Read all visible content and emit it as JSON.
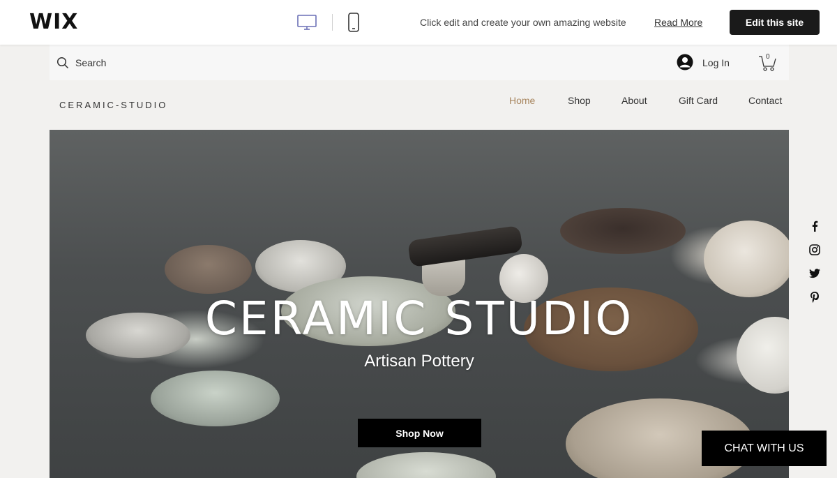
{
  "wix_bar": {
    "logo": "WIX",
    "promo_text": "Click edit and create your own amazing website",
    "read_more_label": "Read More",
    "edit_label": "Edit this site",
    "desktop_icon": "desktop-icon",
    "mobile_icon": "mobile-icon",
    "active_device": "desktop"
  },
  "site_header": {
    "search_label": "Search",
    "login_label": "Log In",
    "cart_count": "0"
  },
  "brand": "CERAMIC-STUDIO",
  "nav": {
    "items": [
      {
        "label": "Home",
        "active": true
      },
      {
        "label": "Shop",
        "active": false
      },
      {
        "label": "About",
        "active": false
      },
      {
        "label": "Gift Card",
        "active": false
      },
      {
        "label": "Contact",
        "active": false
      }
    ]
  },
  "hero": {
    "title": "CERAMIC STUDIO",
    "subtitle": "Artisan Pottery",
    "cta_label": "Shop Now"
  },
  "social": [
    "facebook-icon",
    "instagram-icon",
    "twitter-icon",
    "pinterest-icon"
  ],
  "chat_label": "CHAT WITH US",
  "colors": {
    "accent": "#a8865f",
    "wix_button": "#1a1a1a",
    "device_icon_active": "#6a6fb5"
  }
}
